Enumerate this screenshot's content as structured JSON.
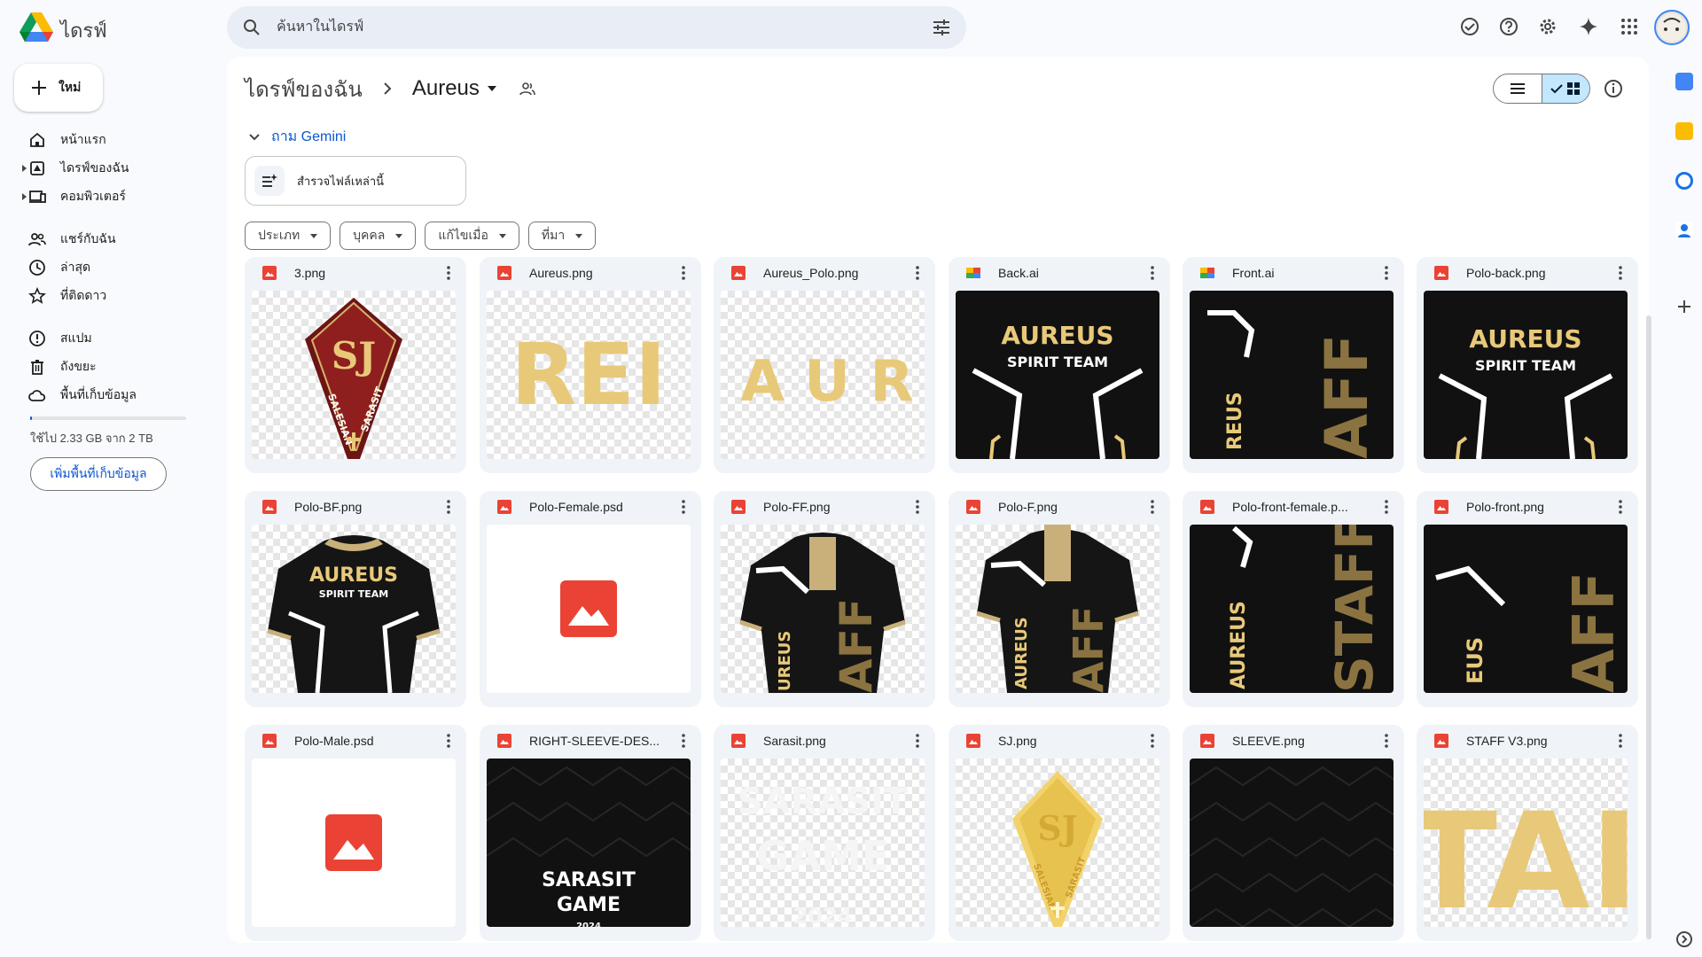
{
  "app": {
    "title": "ไดรฟ์"
  },
  "search": {
    "placeholder": "ค้นหาในไดรฟ์"
  },
  "sidebar": {
    "new_label": "ใหม่",
    "items": [
      {
        "label": "หน้าแรก",
        "icon": "home-icon"
      },
      {
        "label": "ไดรฟ์ของฉัน",
        "icon": "my-drive-icon"
      },
      {
        "label": "คอมพิวเตอร์",
        "icon": "computer-icon"
      },
      {
        "label": "แชร์กับฉัน",
        "icon": "shared-icon"
      },
      {
        "label": "ล่าสุด",
        "icon": "clock-icon"
      },
      {
        "label": "ที่ติดดาว",
        "icon": "star-icon"
      },
      {
        "label": "สแปม",
        "icon": "spam-icon"
      },
      {
        "label": "ถังขยะ",
        "icon": "trash-icon"
      },
      {
        "label": "พื้นที่เก็บข้อมูล",
        "icon": "cloud-icon"
      }
    ],
    "storage_text": "ใช้ไป 2.33 GB จาก 2 TB",
    "storage_button": "เพิ่มพื้นที่เก็บข้อมูล"
  },
  "breadcrumb": {
    "root": "ไดรฟ์ของฉัน",
    "current": "Aureus"
  },
  "gemini": {
    "label": "ถาม Gemini",
    "suggestion": "สำรวจไฟล์เหล่านี้"
  },
  "filters": [
    "ประเภท",
    "บุคคล",
    "แก้ไขเมื่อ",
    "ที่มา"
  ],
  "files": [
    {
      "name": "3.png",
      "kind": "image"
    },
    {
      "name": "Aureus.png",
      "kind": "image"
    },
    {
      "name": "Aureus_Polo.png",
      "kind": "image"
    },
    {
      "name": "Back.ai",
      "kind": "ai"
    },
    {
      "name": "Front.ai",
      "kind": "ai"
    },
    {
      "name": "Polo-back.png",
      "kind": "image"
    },
    {
      "name": "Polo-BF.png",
      "kind": "image"
    },
    {
      "name": "Polo-Female.psd",
      "kind": "image"
    },
    {
      "name": "Polo-FF.png",
      "kind": "image"
    },
    {
      "name": "Polo-F.png",
      "kind": "image"
    },
    {
      "name": "Polo-front-female.p...",
      "kind": "image"
    },
    {
      "name": "Polo-front.png",
      "kind": "image"
    },
    {
      "name": "Polo-Male.psd",
      "kind": "image"
    },
    {
      "name": "RIGHT-SLEEVE-DES...",
      "kind": "image"
    },
    {
      "name": "Sarasit.png",
      "kind": "image"
    },
    {
      "name": "SJ.png",
      "kind": "image"
    },
    {
      "name": "SLEEVE.png",
      "kind": "image"
    },
    {
      "name": "STAFF V3.png",
      "kind": "image"
    }
  ],
  "thumb_text": {
    "aureus": "AUREUS",
    "spirit": "SPIRIT TEAM",
    "aureus_crop": "REI",
    "aureus_spaced": "A U R",
    "staff": "AFF",
    "staff_big": "STAFF",
    "aureus_vertical": "AUREUS",
    "eus_vertical": "EUS",
    "ureus_vertical": "UREUS",
    "reus_vertical": "REUS",
    "sarasit": "SARASIT",
    "game": "GAME",
    "year": "2024",
    "tai": "TAI",
    "salesian": "SALESIAN",
    "sarasit_badge": "SARASIT",
    "sj": "SJ"
  },
  "colors": {
    "accent": "#0b57d0",
    "gold": "#e8c979",
    "image_red": "#ea4335",
    "dark_shirt": "#151515"
  }
}
